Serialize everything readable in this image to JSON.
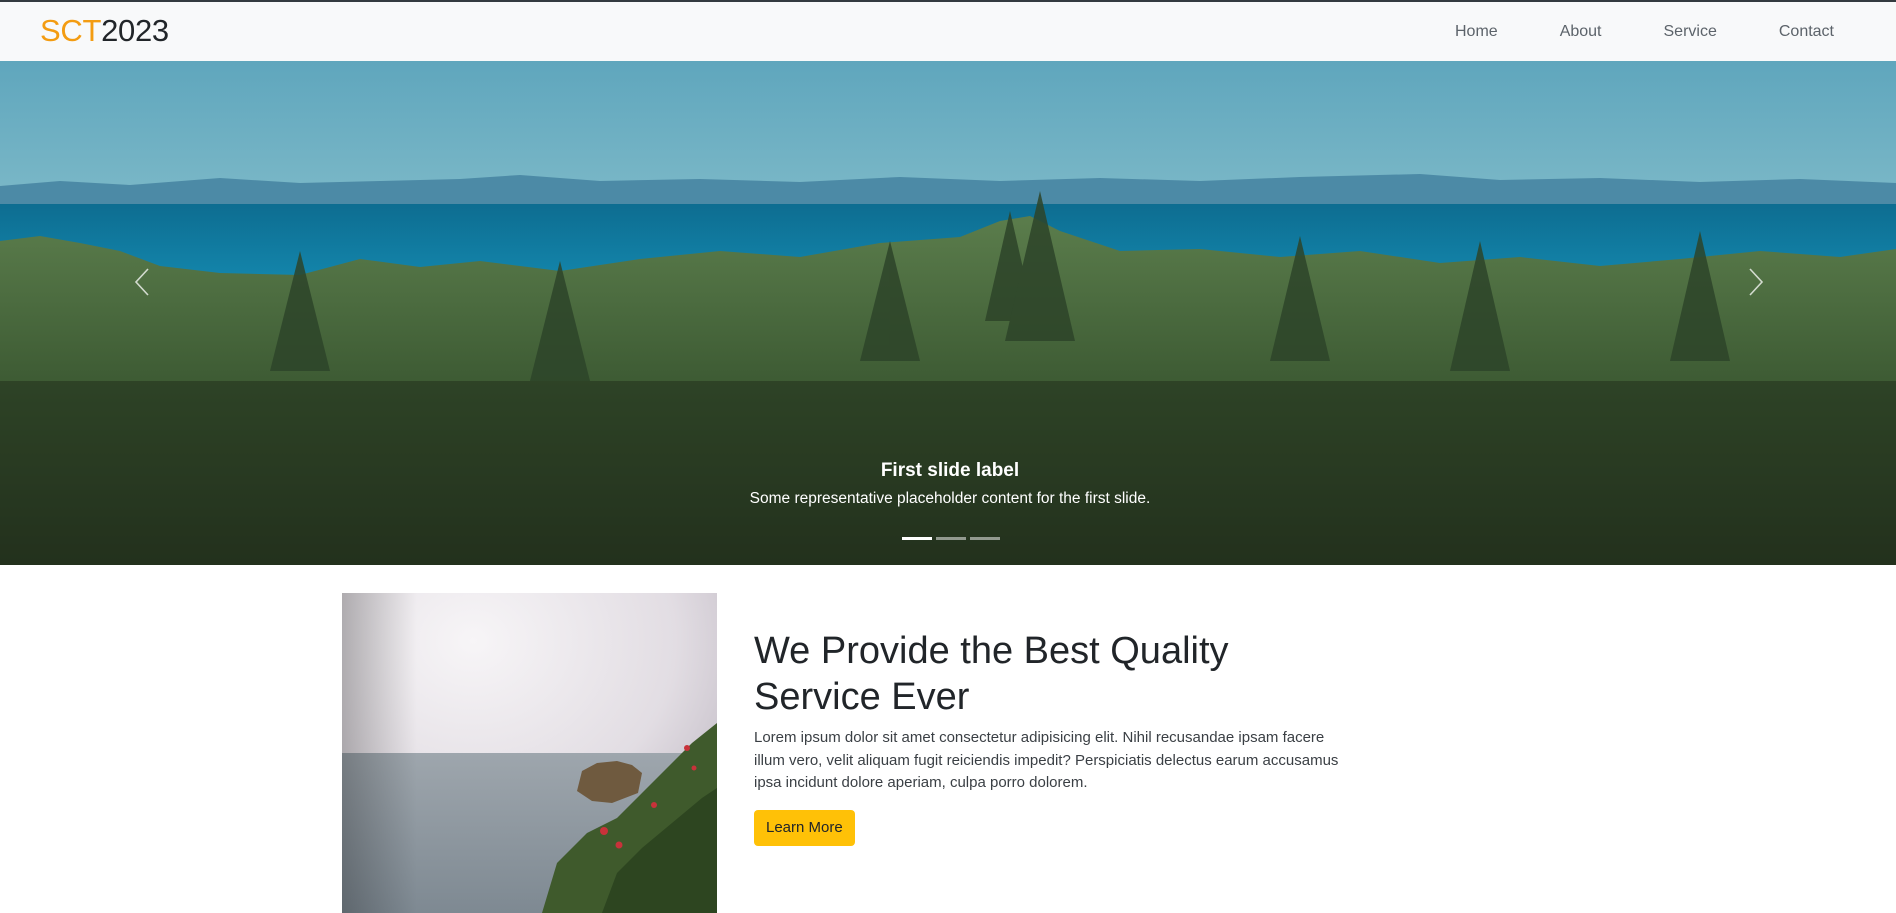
{
  "brand": {
    "part1": "SCT",
    "part2": "2023",
    "accent_color": "#f39c12"
  },
  "nav": {
    "items": [
      "Home",
      "About",
      "Service",
      "Contact"
    ]
  },
  "carousel": {
    "caption_title": "First slide label",
    "caption_text": "Some representative placeholder content for the first slide.",
    "slide_count": 3,
    "active_index": 0,
    "prev_icon": "chevron-left-icon",
    "next_icon": "chevron-right-icon"
  },
  "feature": {
    "title": "We Provide the Best Quality Service Ever",
    "body": "Lorem ipsum dolor sit amet consectetur adipisicing elit. Nihil recusandae ipsam facere illum vero, velit aliquam fugit reiciendis impedit? Perspiciatis delectus earum accusamus ipsa incidunt dolore aperiam, culpa porro dolorem.",
    "button_label": "Learn More",
    "button_color": "#ffc107"
  }
}
